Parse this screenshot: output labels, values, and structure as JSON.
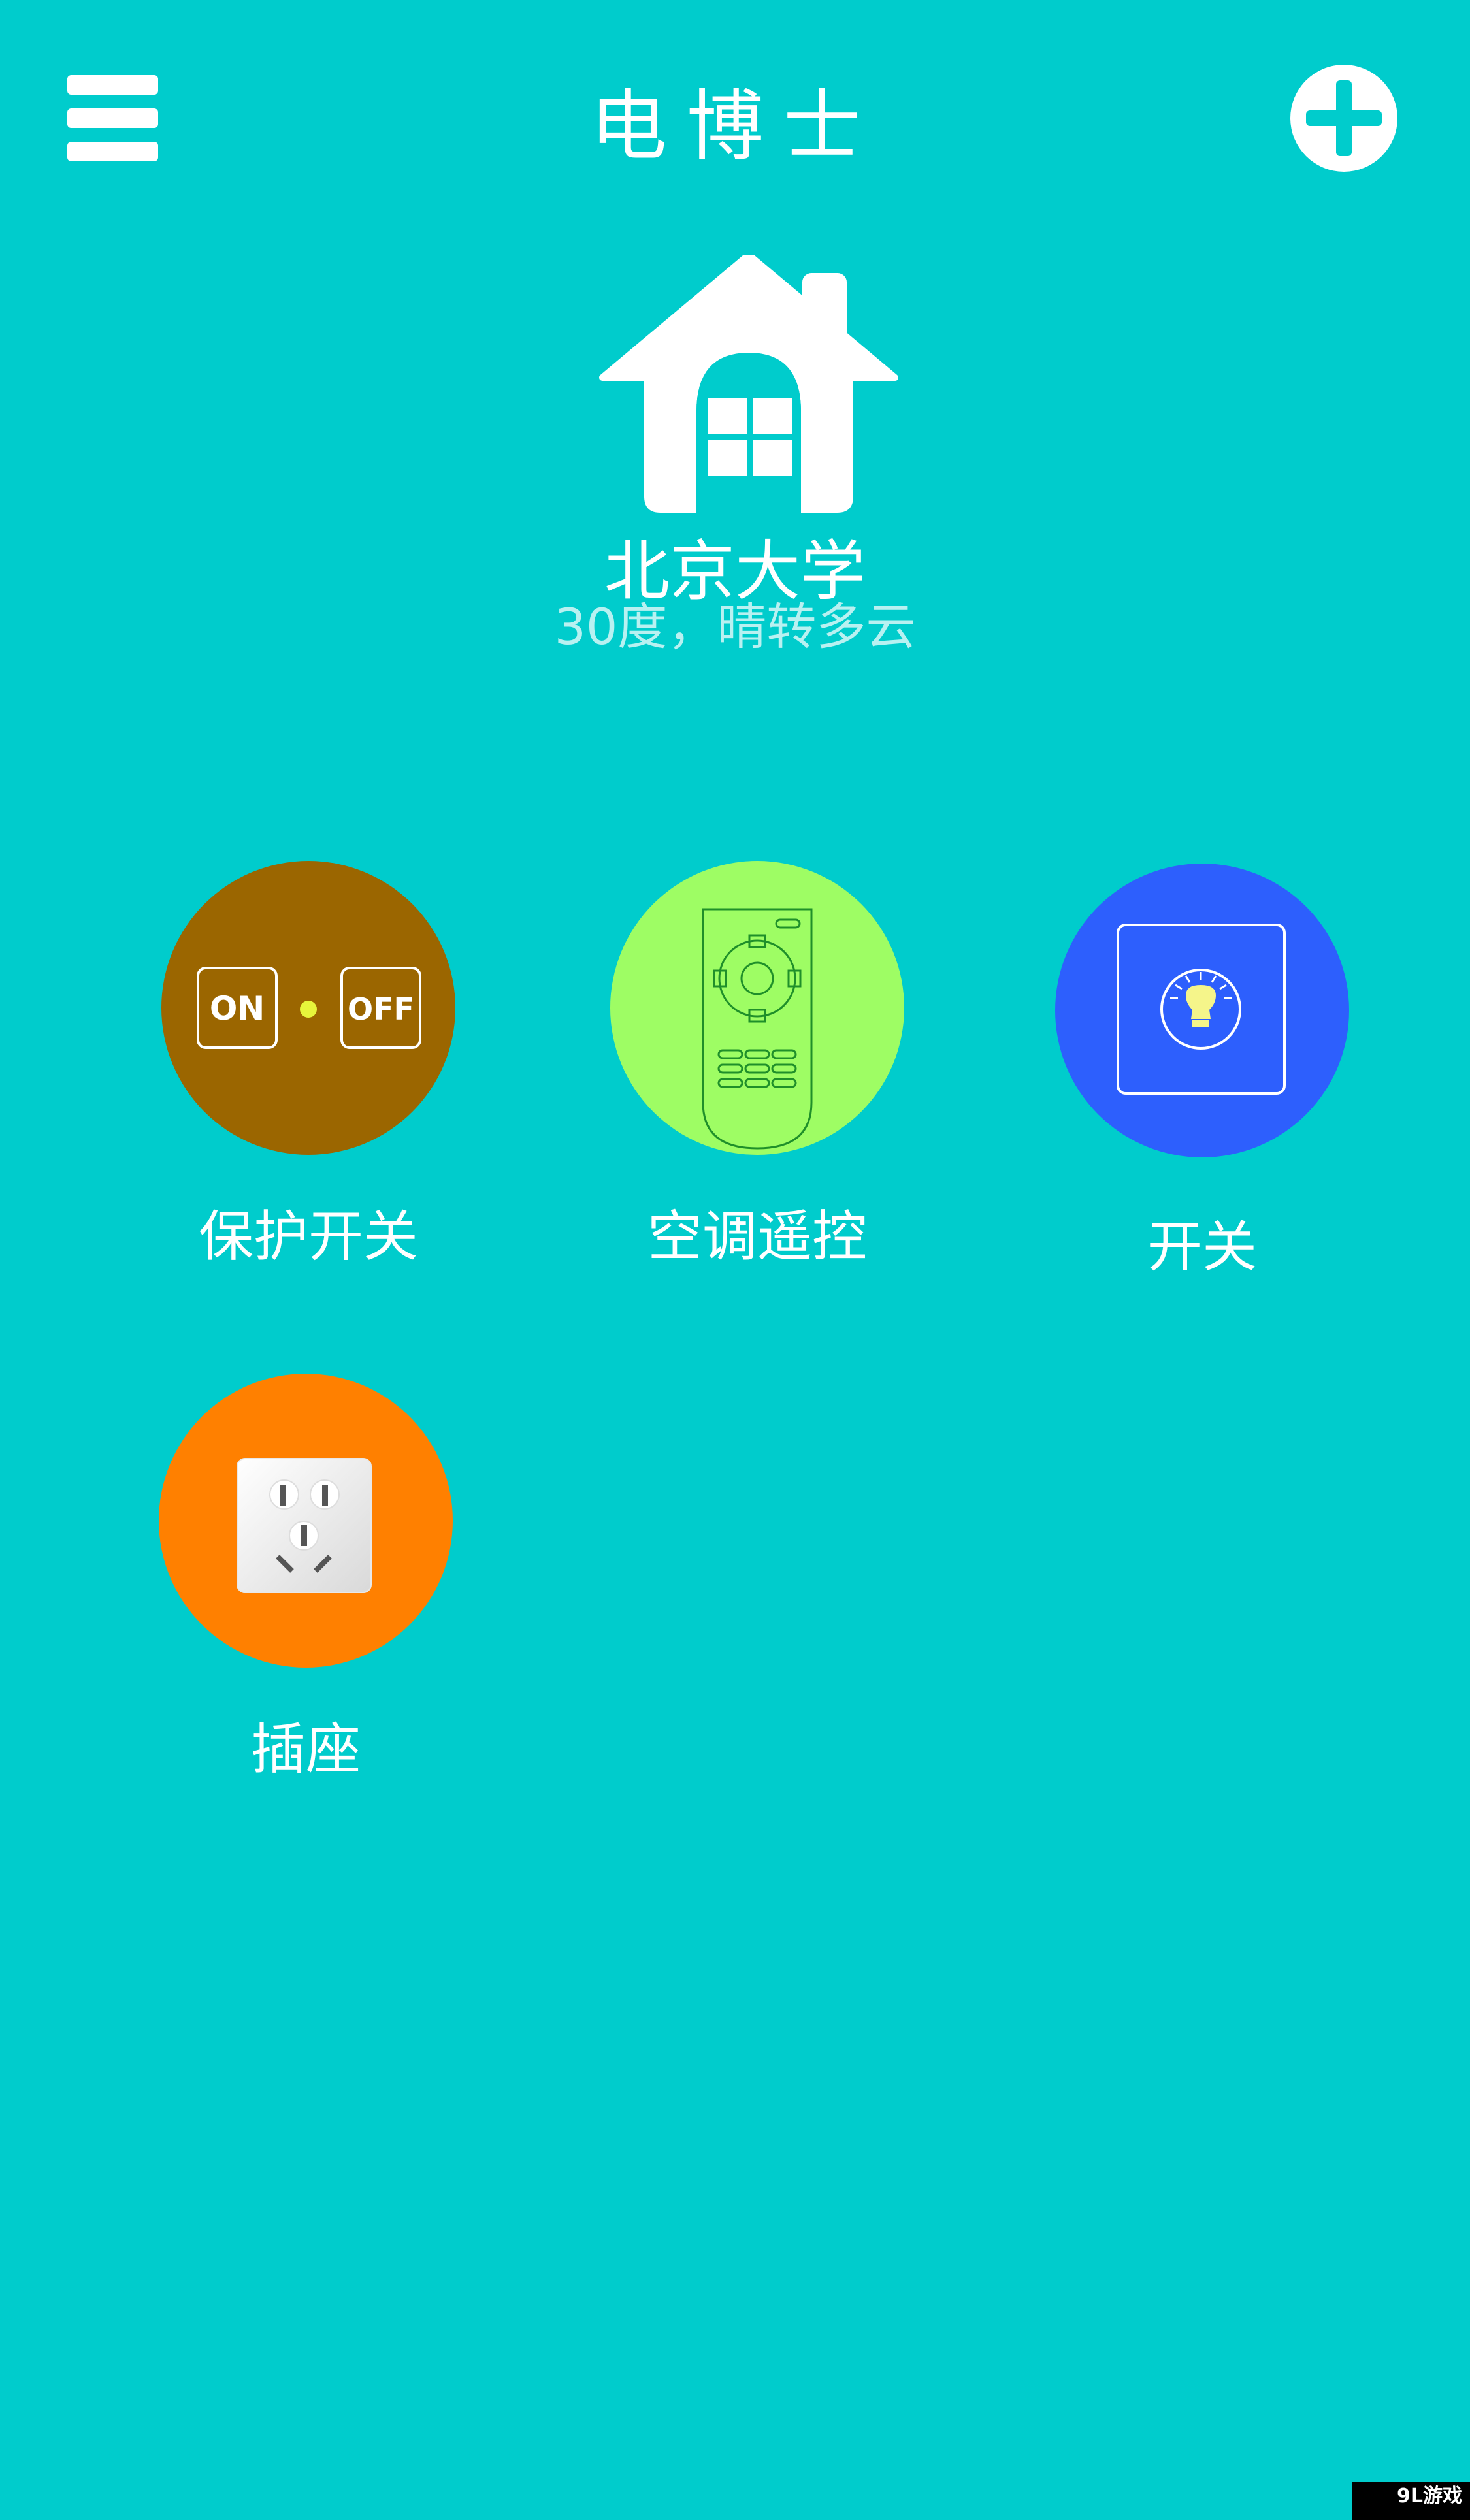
{
  "colors": {
    "background": "#00cccc",
    "white": "#ffffff",
    "weather_text": "#b8f1f1"
  },
  "header": {
    "title": "电博士",
    "menu_icon": "hamburger-menu-icon",
    "add_icon": "plus-circle-icon"
  },
  "home": {
    "icon": "house-icon",
    "location": "北京大学",
    "weather": "30度，晴转多云"
  },
  "devices": [
    {
      "label": "保护开关",
      "icon": "on-off-switch-icon",
      "color": "#9b6600"
    },
    {
      "label": "空调遥控",
      "icon": "remote-control-icon",
      "color": "#9efd64"
    },
    {
      "label": "开关",
      "icon": "light-switch-icon",
      "color": "#2d5ffd"
    },
    {
      "label": "插座",
      "icon": "power-socket-icon",
      "color": "#ff8000"
    }
  ],
  "onoff": {
    "on_text": "ON",
    "off_text": "OFF",
    "dot_color": "#e7f53b"
  },
  "watermark": "9L游戏"
}
